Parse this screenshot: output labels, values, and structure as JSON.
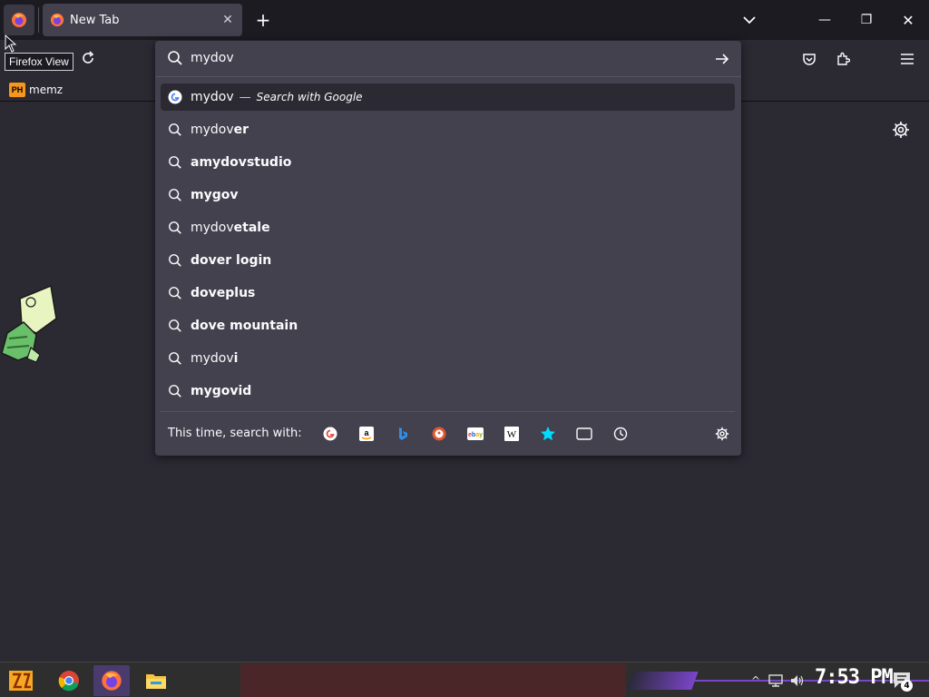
{
  "browser": {
    "tab": {
      "title": "New Tab",
      "close": "✕"
    },
    "new_tab": "+",
    "firefox_view_tooltip": "Firefox View"
  },
  "window_controls": {
    "minimize": "—",
    "maximize": "❐",
    "close": "✕"
  },
  "bookmarks": [
    {
      "badge": "PH",
      "label": "memz"
    }
  ],
  "urlbar": {
    "value": "mydov",
    "heuristic": {
      "query": "mydov",
      "dash": "—",
      "action": "Search with Google"
    },
    "suggestions": [
      {
        "typed": "mydov",
        "rest": "er"
      },
      {
        "typed": "amydov",
        "rest": "studio",
        "bold_all": true
      },
      {
        "typed": "mygov",
        "rest": "",
        "bold_all": true
      },
      {
        "typed": "mydov",
        "rest": "etale"
      },
      {
        "typed": "dover login",
        "rest": "",
        "bold_all": true
      },
      {
        "typed": "doveplus",
        "rest": "",
        "bold_all": true
      },
      {
        "typed": "dove mountain",
        "rest": "",
        "bold_all": true
      },
      {
        "typed": "mydov",
        "rest": "i"
      },
      {
        "typed": "mygovid",
        "rest": "",
        "bold_all": true
      }
    ],
    "oneoff_label": "This time, search with:",
    "engines": [
      "google-icon",
      "amazon-icon",
      "bing-icon",
      "duckduckgo-icon",
      "ebay-icon",
      "wikipedia-icon",
      "bookmarks-icon",
      "tabs-icon",
      "history-icon"
    ]
  },
  "taskbar": {
    "clock": "7:53 PM",
    "notification_count": "4"
  },
  "colors": {
    "accent": "#7a45c8",
    "panel": "#42414d",
    "toolbar": "#2b2a33",
    "tabstrip": "#1c1b22"
  }
}
